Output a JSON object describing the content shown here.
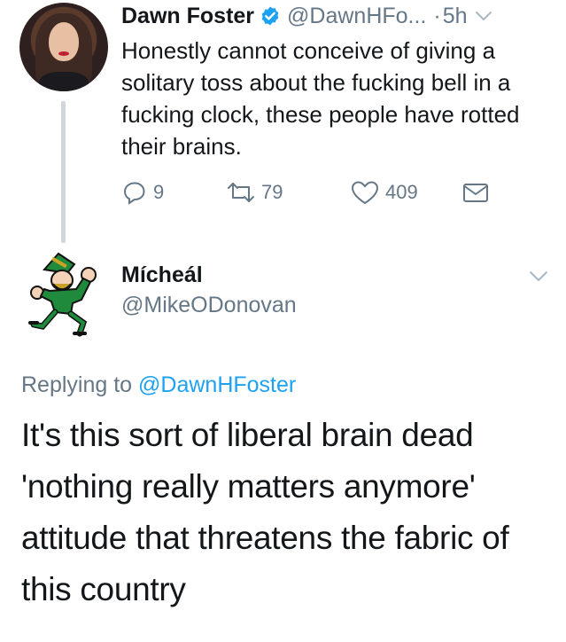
{
  "parent_tweet": {
    "author_name": "Dawn Foster",
    "verified": true,
    "handle": "@DawnHFo...",
    "separator": "·",
    "time": "5h",
    "text": "Honestly cannot conceive of giving a solitary toss about the fucking bell in a fucking clock, these people have rotted their brains.",
    "actions": {
      "reply_count": "9",
      "retweet_count": "79",
      "like_count": "409"
    }
  },
  "reply_tweet": {
    "author_name": "Mícheál",
    "handle": "@MikeODonovan",
    "replying_prefix": "Replying to",
    "replying_mention": "@DawnHFoster",
    "text": "It's this sort of liberal brain dead 'nothing really matters anymore' attitude that threatens the fabric of this country"
  },
  "icons": {
    "verified": "verified-badge-icon",
    "menu": "chevron-down-icon",
    "reply": "reply-icon",
    "retweet": "retweet-icon",
    "like": "heart-icon",
    "dm": "envelope-icon"
  },
  "colors": {
    "text": "#14171a",
    "secondary": "#657786",
    "link": "#1da1f2",
    "verified": "#1da1f2",
    "thread_line": "#d0d6dc",
    "leprechaun_green": "#1f8a3c"
  }
}
